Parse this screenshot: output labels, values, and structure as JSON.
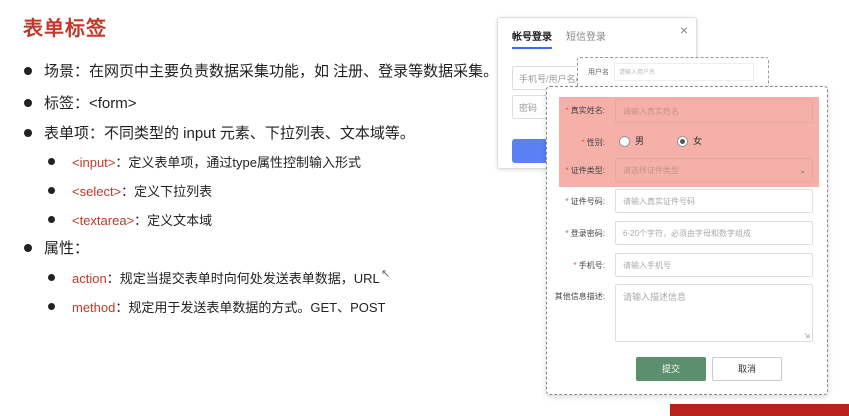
{
  "title": "表单标签",
  "bullets": [
    {
      "text": "场景：在网页中主要负责数据采集功能，如 注册、登录等数据采集。"
    },
    {
      "text": "标签：<form>"
    },
    {
      "text": "表单项：不同类型的 input 元素、下拉列表、文本域等。"
    },
    {
      "kw": "<input>",
      "text": "：定义表单项，通过type属性控制输入形式"
    },
    {
      "kw": "<select>",
      "text": "：定义下拉列表"
    },
    {
      "kw": "<textarea>",
      "text": "：定义文本域"
    },
    {
      "text": "属性："
    },
    {
      "kw": "action",
      "text": "：规定当提交表单时向何处发送表单数据，URL"
    },
    {
      "kw": "method",
      "text": "：规定用于发送表单数据的方式。GET、POST"
    }
  ],
  "login": {
    "tab_account": "帐号登录",
    "tab_sms": "短信登录",
    "close": "×",
    "username_placeholder": "手机号/用户名/邮",
    "password_placeholder": "密码"
  },
  "dashed_card": {
    "label": "用户名",
    "placeholder": "请输入用户名"
  },
  "register": {
    "fields": [
      {
        "label": "真实姓名:",
        "required": true,
        "placeholder": "请输入真实姓名"
      },
      {
        "label": "性别:",
        "required": true,
        "options": [
          "男",
          "女"
        ],
        "selected": "女"
      },
      {
        "label": "证件类型:",
        "required": true,
        "placeholder": "请选择证件类型"
      },
      {
        "label": "证件号码:",
        "required": true,
        "placeholder": "请输入真实证件号码"
      },
      {
        "label": "登录密码:",
        "required": true,
        "placeholder": "6-20个字符，必须由字母和数字组成"
      },
      {
        "label": "手机号:",
        "required": true,
        "placeholder": "请输入手机号"
      },
      {
        "label": "其他信息描述:",
        "required": false,
        "placeholder": "请输入描述信息"
      }
    ],
    "submit_label": "提交",
    "cancel_label": "取消"
  },
  "colors": {
    "title": "#c0392b",
    "keyword": "#c0392b",
    "highlight": "#f5b0aa",
    "submit": "#5c8f6e",
    "login_button": "#5b7ff5"
  }
}
